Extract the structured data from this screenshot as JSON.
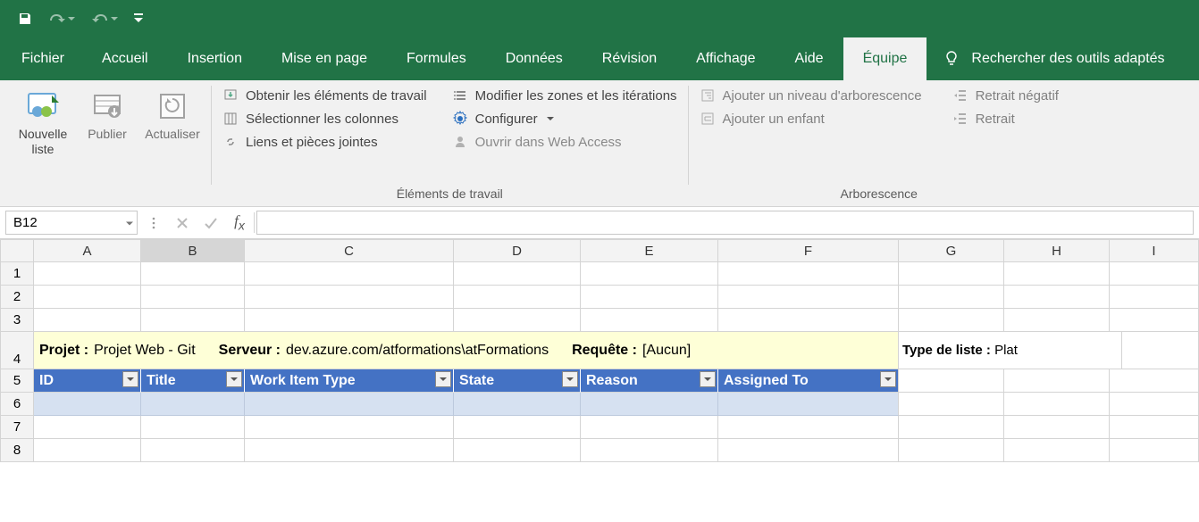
{
  "qat": {
    "customize_tip": "Personnaliser"
  },
  "tabs": {
    "items": [
      "Fichier",
      "Accueil",
      "Insertion",
      "Mise en page",
      "Formules",
      "Données",
      "Révision",
      "Affichage",
      "Aide",
      "Équipe"
    ],
    "active_index": 9,
    "tellme": "Rechercher des outils adaptés"
  },
  "ribbon": {
    "group1": {
      "new_list": "Nouvelle liste",
      "publish": "Publier",
      "refresh": "Actualiser"
    },
    "group2": {
      "get": "Obtenir les éléments de travail",
      "select_cols": "Sélectionner les colonnes",
      "links": "Liens et pièces jointes",
      "edit_areas": "Modifier les zones et les itérations",
      "configure": "Configurer",
      "open_web": "Ouvrir dans Web Access",
      "label": "Éléments de travail"
    },
    "group3": {
      "add_level": "Ajouter un niveau d'arborescence",
      "add_child": "Ajouter un enfant",
      "outdent": "Retrait négatif",
      "indent": "Retrait",
      "label": "Arborescence"
    }
  },
  "formula": {
    "namebox": "B12",
    "value": ""
  },
  "columns": [
    "A",
    "B",
    "C",
    "D",
    "E",
    "F",
    "G",
    "H",
    "I"
  ],
  "rows": [
    "1",
    "2",
    "3",
    "4",
    "5",
    "6",
    "7",
    "8"
  ],
  "info": {
    "project_lbl": "Projet :",
    "project_val": "Projet Web - Git",
    "server_lbl": "Serveur :",
    "server_val": "dev.azure.com/atformations\\atFormations",
    "query_lbl": "Requête :",
    "query_val": "[Aucun]",
    "listtype_lbl": "Type de liste :",
    "listtype_val": "Plat"
  },
  "table_headers": [
    "ID",
    "Title",
    "Work Item Type",
    "State",
    "Reason",
    "Assigned To"
  ]
}
